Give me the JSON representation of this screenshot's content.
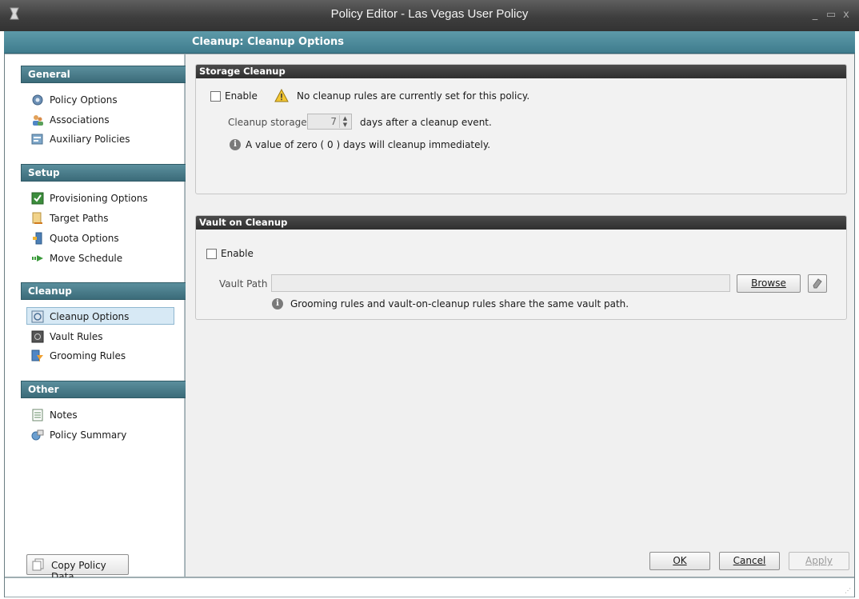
{
  "window": {
    "title": "Policy Editor - Las Vegas User Policy",
    "minimize_glyph": "_",
    "maximize_glyph": "▭",
    "close_glyph": "x"
  },
  "header": {
    "title": "Cleanup: Cleanup Options"
  },
  "sidebar": {
    "sections": [
      {
        "label": "General",
        "items": [
          {
            "label": "Policy Options",
            "icon": "gear-icon"
          },
          {
            "label": "Associations",
            "icon": "users-icon"
          },
          {
            "label": "Auxiliary Policies",
            "icon": "policy-icon"
          }
        ]
      },
      {
        "label": "Setup",
        "items": [
          {
            "label": "Provisioning Options",
            "icon": "checkmark-icon"
          },
          {
            "label": "Target Paths",
            "icon": "target-path-icon"
          },
          {
            "label": "Quota Options",
            "icon": "quota-icon"
          },
          {
            "label": "Move Schedule",
            "icon": "move-arrow-icon"
          }
        ]
      },
      {
        "label": "Cleanup",
        "items": [
          {
            "label": "Cleanup Options",
            "icon": "cleanup-icon",
            "selected": true
          },
          {
            "label": "Vault Rules",
            "icon": "vault-icon"
          },
          {
            "label": "Grooming Rules",
            "icon": "funnel-icon"
          }
        ]
      },
      {
        "label": "Other",
        "items": [
          {
            "label": "Notes",
            "icon": "notes-icon"
          },
          {
            "label": "Policy Summary",
            "icon": "summary-icon"
          }
        ]
      }
    ],
    "copy_button_label": "Copy Policy Data"
  },
  "storage_cleanup": {
    "title": "Storage Cleanup",
    "enable_label": "Enable",
    "enable_checked": false,
    "warning_text": "No cleanup rules are currently set for this policy.",
    "cleanup_label": "Cleanup storage",
    "days_value": "7",
    "days_suffix": "days after a cleanup event.",
    "info_text": "A value of zero ( 0 ) days will cleanup immediately."
  },
  "vault_on_cleanup": {
    "title": "Vault on Cleanup",
    "enable_label": "Enable",
    "enable_checked": false,
    "vault_path_label": "Vault Path",
    "vault_path_value": "",
    "browse_label": "Browse",
    "info_text": "Grooming rules and vault-on-cleanup rules share the same vault path."
  },
  "footer": {
    "ok_label": "OK",
    "cancel_label": "Cancel",
    "apply_label": "Apply"
  },
  "colors": {
    "header_teal": "#4a8798",
    "section_teal": "#4b7e8c",
    "group_header": "#333333",
    "selected_item": "#d7e9f5"
  }
}
